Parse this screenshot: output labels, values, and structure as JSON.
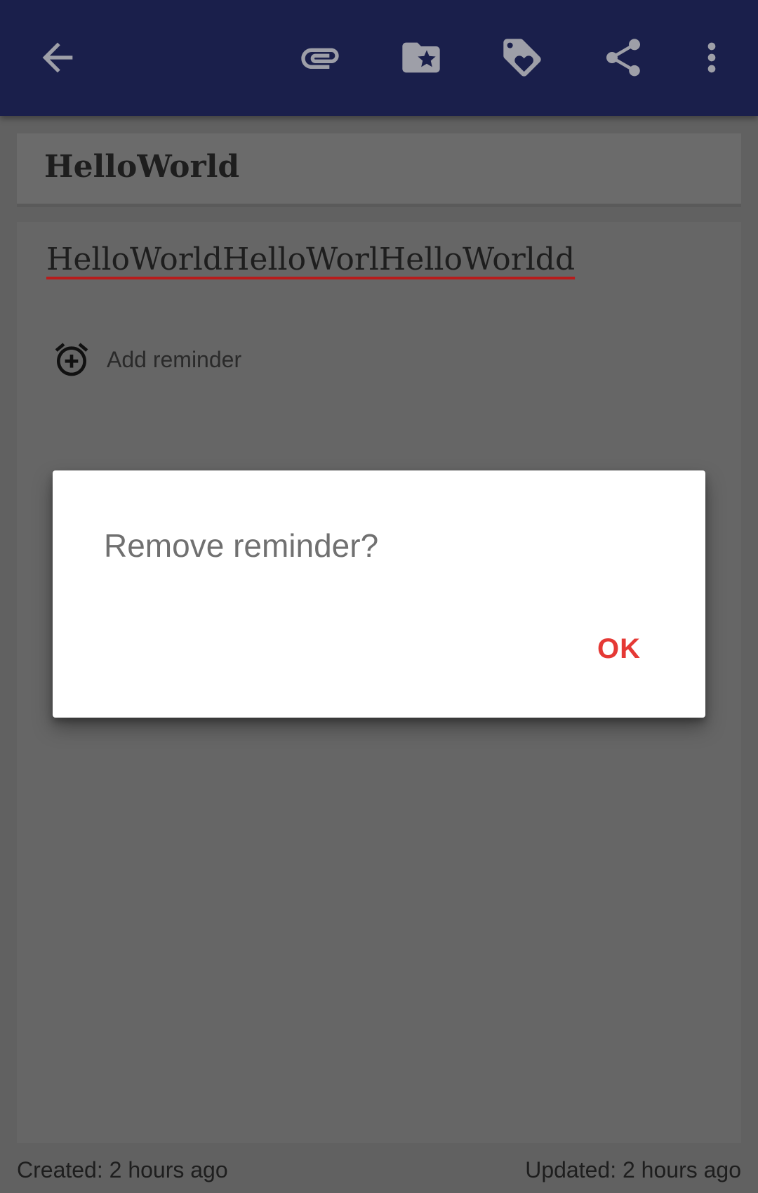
{
  "toolbar": {
    "background": "#1a1f4b",
    "icons": [
      "back-arrow-icon",
      "paperclip-icon",
      "folder-star-icon",
      "tag-heart-icon",
      "share-icon",
      "more-vert-icon"
    ]
  },
  "note": {
    "title": "HelloWorld",
    "content": "HelloWorldHelloWorlHelloWorldd",
    "reminder_label": "Add reminder",
    "spellcheck_underline_color": "#b71c1c"
  },
  "footer": {
    "created": "Created: 2 hours ago",
    "updated": "Updated: 2 hours ago"
  },
  "dialog": {
    "title": "Remove reminder?",
    "ok_label": "OK",
    "accent": "#e53935"
  }
}
